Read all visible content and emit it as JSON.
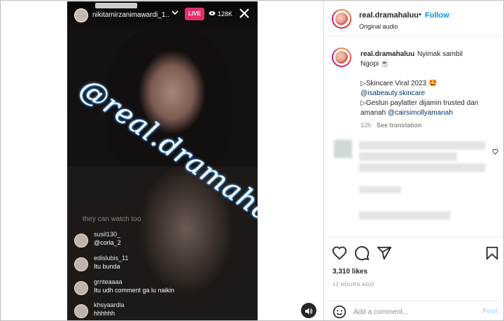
{
  "live": {
    "username": "nikitamirzanimawardi_1...",
    "badge": "LIVE",
    "viewer_count": "128K",
    "watermark": "@real.dramahaluu",
    "faint_comment": "they can watch too",
    "comments": [
      {
        "user": "susil130_",
        "text": "@corla_2"
      },
      {
        "user": "edislubis_11",
        "text": "Itu bunda"
      },
      {
        "user": "grnteaaaa",
        "text": "Itu udh comment ga lu naikin"
      },
      {
        "user": "khsyaardla",
        "text": "hhhhhh"
      }
    ]
  },
  "post": {
    "username": "real.dramahaluu",
    "dot": "•",
    "follow_label": "Follow",
    "audio": "Original audio",
    "caption": {
      "lead": "Nyimak sambil",
      "line2": "Ngopi ☕",
      "line3": "▷Skincare Viral 2023 🤩",
      "mention1": "@isabeauty.skincare",
      "line5": "▷Gestun paylatter dijamin trusted dan",
      "line6_prefix": "amanah ",
      "mention2": "@cairsimollyamanah",
      "time": "12h",
      "see_translation": "See translation"
    },
    "likes": "3,310 likes",
    "time_ago": "12 HOURS AGO",
    "comment_placeholder": "Add a comment...",
    "post_label": "Post"
  },
  "colors": {
    "accent": "#0095f6",
    "live": "#e1306c",
    "mention": "#00376b",
    "muted": "#8e8e8e"
  },
  "icons": [
    "like-heart-icon",
    "comment-bubble-icon",
    "share-plane-icon",
    "bookmark-icon",
    "emoji-icon",
    "close-icon",
    "eye-icon",
    "speaker-icon",
    "chevron-down-icon"
  ]
}
